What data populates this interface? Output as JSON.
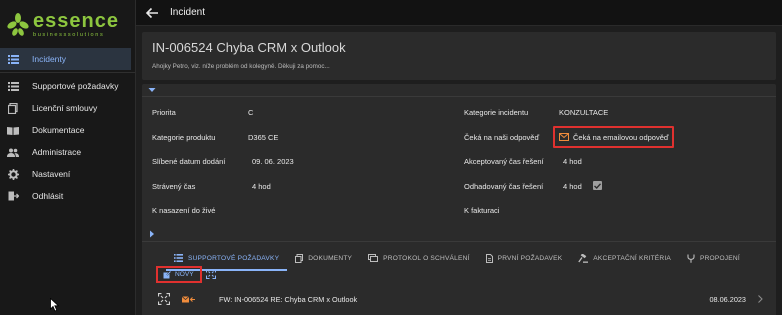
{
  "logo": {
    "word": "essence",
    "tagline": "businesssolutions"
  },
  "sidebar": {
    "items": [
      {
        "label": "Incidenty",
        "icon": "list-icon",
        "active": true
      },
      {
        "label": "Supportové požadavky",
        "icon": "list-icon",
        "active": false
      },
      {
        "label": "Licenční smlouvy",
        "icon": "document-copy-icon",
        "active": false
      },
      {
        "label": "Dokumentace",
        "icon": "book-icon",
        "active": false
      },
      {
        "label": "Administrace",
        "icon": "people-icon",
        "active": false
      },
      {
        "label": "Nastavení",
        "icon": "gear-icon",
        "active": false
      },
      {
        "label": "Odhlásit",
        "icon": "logout-icon",
        "active": false
      }
    ]
  },
  "topbar": {
    "title": "Incident"
  },
  "incident": {
    "title": "IN-006524 Chyba CRM x Outlook",
    "description": "Ahojky Petro,  viz. níže problém od kolegyně.  Děkuji za pomoc..."
  },
  "fields": {
    "priority_label": "Priorita",
    "priority_value": "C",
    "category_label": "Kategorie incidentu",
    "category_value": "KONZULTACE",
    "product_label": "Kategorie produktu",
    "product_value": "D365 CE",
    "waiting_label": "Čeká na naši odpověď",
    "waiting_value": "Čeká na emailovou odpověď",
    "promised_label": "Slíbené datum dodání",
    "promised_value": "09. 06. 2023",
    "accepted_label": "Akceptovaný čas řešení",
    "accepted_value": "4 hod",
    "spent_label": "Strávený čas",
    "spent_value": "4 hod",
    "estimated_label": "Odhadovaný čas řešení",
    "estimated_value": "4 hod",
    "estimated_checked": true,
    "deploy_label": "K nasazení do živé",
    "invoice_label": "K fakturaci"
  },
  "tabs": [
    {
      "label": "SUPPORTOVÉ POŽADAVKY",
      "icon": "list-icon",
      "active": true
    },
    {
      "label": "DOKUMENTY",
      "icon": "document-copy-icon",
      "active": false
    },
    {
      "label": "PROTOKOL O SCHVÁLENÍ",
      "icon": "protocol-icon",
      "active": false
    },
    {
      "label": "PRVNÍ POŽADAVEK",
      "icon": "document-icon",
      "active": false
    },
    {
      "label": "AKCEPTAČNÍ KRITÉRIA",
      "icon": "gavel-icon",
      "active": false
    },
    {
      "label": "PROPOJENÍ",
      "icon": "merge-icon",
      "active": false
    }
  ],
  "actions": {
    "new_label": "NOVÝ"
  },
  "requests": [
    {
      "subject": "FW: IN-006524 RE: Chyba CRM x Outlook",
      "date": "08.06.2023"
    }
  ],
  "colors": {
    "accent": "#8ab4f8",
    "highlight": "#e0312f",
    "brand": "#8dc63f",
    "envelope": "#f08c3c"
  }
}
